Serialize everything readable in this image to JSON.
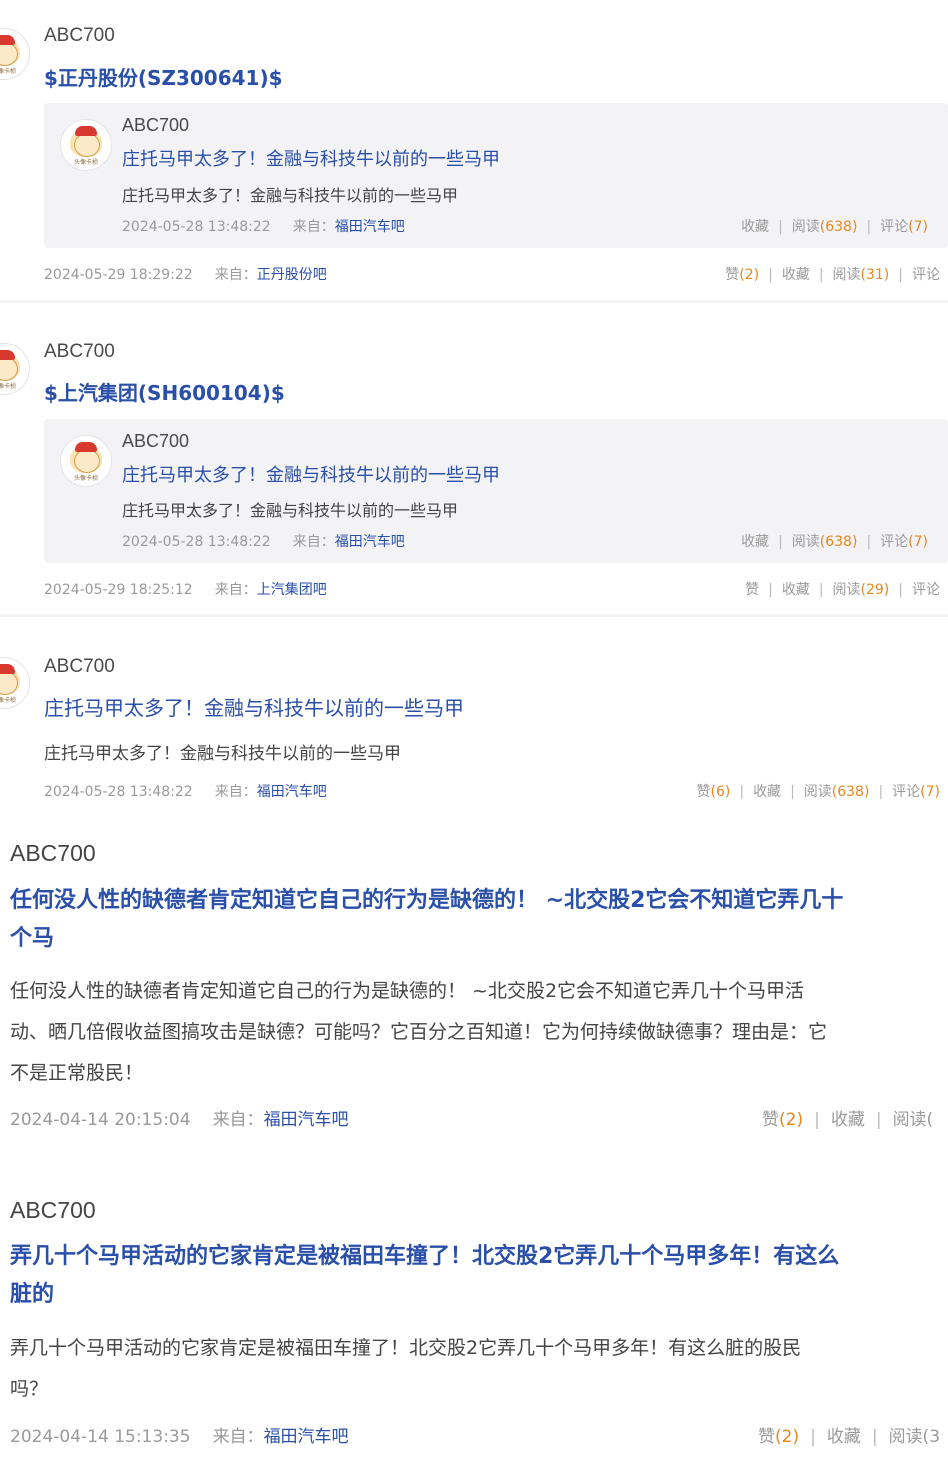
{
  "posts": [
    {
      "user": "ABC700",
      "stock": "$正丹股份(SZ300641)$",
      "quote": {
        "user": "ABC700",
        "title": "庄托马甲太多了！金融与科技牛以前的一些马甲",
        "body": "庄托马甲太多了！金融与科技牛以前的一些马甲",
        "time": "2024-05-28 13:48:22",
        "from_label": "来自：",
        "source": "福田汽车吧",
        "fav": "收藏",
        "read_label": "阅读",
        "read": "(638)",
        "comment_label": "评论",
        "comment": "(7)"
      },
      "time": "2024-05-29 18:29:22",
      "from_label": "来自：",
      "source": "正丹股份吧",
      "like_label": "赞",
      "like": "(2)",
      "fav": "收藏",
      "read_label": "阅读",
      "read": "(31)",
      "comment_label": "评论"
    },
    {
      "user": "ABC700",
      "stock": "$上汽集团(SH600104)$",
      "quote": {
        "user": "ABC700",
        "title": "庄托马甲太多了！金融与科技牛以前的一些马甲",
        "body": "庄托马甲太多了！金融与科技牛以前的一些马甲",
        "time": "2024-05-28 13:48:22",
        "from_label": "来自：",
        "source": "福田汽车吧",
        "fav": "收藏",
        "read_label": "阅读",
        "read": "(638)",
        "comment_label": "评论",
        "comment": "(7)"
      },
      "time": "2024-05-29 18:25:12",
      "from_label": "来自：",
      "source": "上汽集团吧",
      "like_label": "赞",
      "fav": "收藏",
      "read_label": "阅读",
      "read": "(29)",
      "comment_label": "评论"
    },
    {
      "user": "ABC700",
      "title": "庄托马甲太多了！金融与科技牛以前的一些马甲",
      "body": "庄托马甲太多了！金融与科技牛以前的一些马甲",
      "time": "2024-05-28 13:48:22",
      "from_label": "来自：",
      "source": "福田汽车吧",
      "like_label": "赞",
      "like": "(6)",
      "fav": "收藏",
      "read_label": "阅读",
      "read": "(638)",
      "comment_label": "评论",
      "comment": "(7)"
    },
    {
      "user": "ABC700",
      "title_line1": "任何没人性的缺德者肯定知道它自己的行为是缺德的！ ~北交股2它会不知道它弄几十",
      "title_line2": "个马",
      "body_line1": "任何没人性的缺德者肯定知道它自己的行为是缺德的！ ~北交股2它会不知道它弄几十个马甲活",
      "body_line2": "动、晒几倍假收益图搞攻击是缺德？可能吗？它百分之百知道！它为何持续做缺德事？理由是：它",
      "body_line3": "不是正常股民！",
      "time": "2024-04-14 20:15:04",
      "from_label": "来自：",
      "source": "福田汽车吧",
      "like_label": "赞",
      "like": "(2)",
      "fav": "收藏",
      "read_label": "阅读("
    },
    {
      "user": "ABC700",
      "title_line1": "弄几十个马甲活动的它家肯定是被福田车撞了！北交股2它弄几十个马甲多年！有这么",
      "title_line2": "脏的",
      "body_line1": "弄几十个马甲活动的它家肯定是被福田车撞了！北交股2它弄几十个马甲多年！有这么脏的股民",
      "body_line2": "吗？",
      "time": "2024-04-14 15:13:35",
      "from_label": "来自：",
      "source": "福田汽车吧",
      "like_label": "赞",
      "like": "(2)",
      "fav": "收藏",
      "read_label": "阅读(3"
    }
  ],
  "avatar_text": "头像卡桢"
}
